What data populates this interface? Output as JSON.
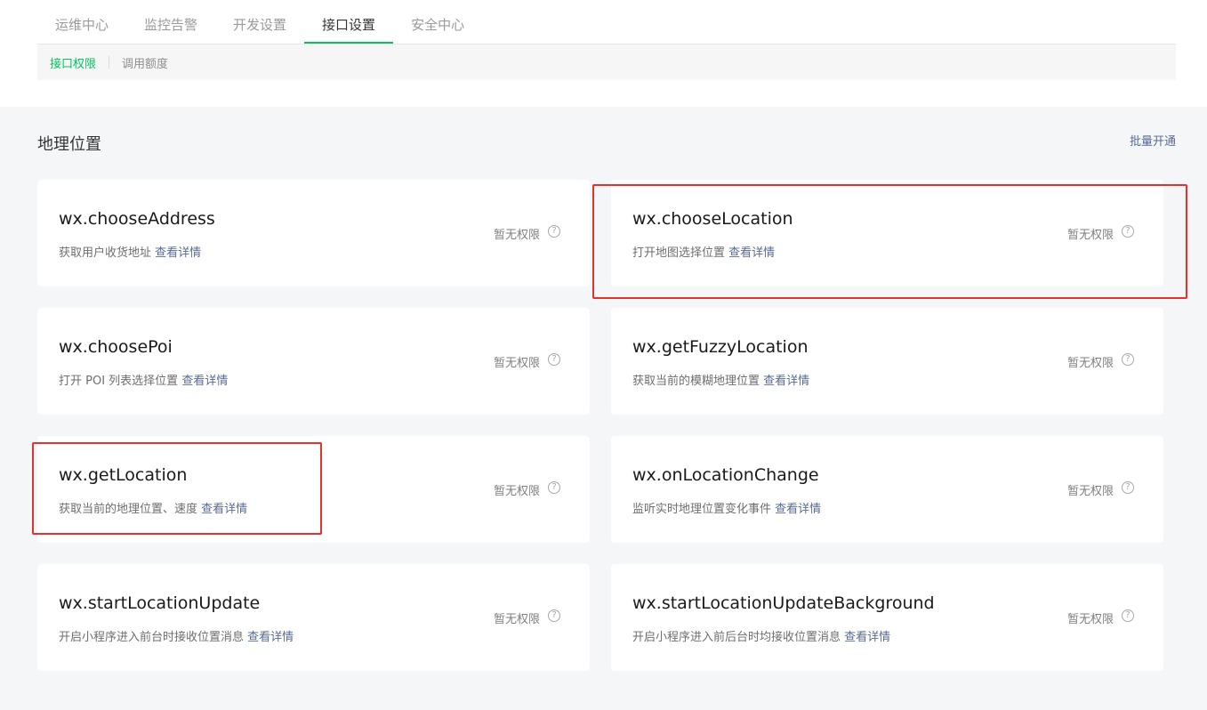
{
  "tabs": [
    {
      "label": "运维中心",
      "active": false
    },
    {
      "label": "监控告警",
      "active": false
    },
    {
      "label": "开发设置",
      "active": false
    },
    {
      "label": "接口设置",
      "active": true
    },
    {
      "label": "安全中心",
      "active": false
    }
  ],
  "subtabs": [
    {
      "label": "接口权限",
      "active": true
    },
    {
      "label": "调用额度",
      "active": false
    }
  ],
  "section": {
    "title": "地理位置",
    "batch_action": "批量开通"
  },
  "apis": [
    {
      "name": "wx.chooseAddress",
      "desc": "获取用户收货地址",
      "link": "查看详情",
      "status": "暂无权限",
      "help": "?"
    },
    {
      "name": "wx.chooseLocation",
      "desc": "打开地图选择位置",
      "link": "查看详情",
      "status": "暂无权限",
      "help": "?"
    },
    {
      "name": "wx.choosePoi",
      "desc": "打开 POI 列表选择位置",
      "link": "查看详情",
      "status": "暂无权限",
      "help": "?"
    },
    {
      "name": "wx.getFuzzyLocation",
      "desc": "获取当前的模糊地理位置",
      "link": "查看详情",
      "status": "暂无权限",
      "help": "?"
    },
    {
      "name": "wx.getLocation",
      "desc": "获取当前的地理位置、速度",
      "link": "查看详情",
      "status": "暂无权限",
      "help": "?"
    },
    {
      "name": "wx.onLocationChange",
      "desc": "监听实时地理位置变化事件",
      "link": "查看详情",
      "status": "暂无权限",
      "help": "?"
    },
    {
      "name": "wx.startLocationUpdate",
      "desc": "开启小程序进入前台时接收位置消息",
      "link": "查看详情",
      "status": "暂无权限",
      "help": "?"
    },
    {
      "name": "wx.startLocationUpdateBackground",
      "desc": "开启小程序进入前后台时均接收位置消息",
      "link": "查看详情",
      "status": "暂无权限",
      "help": "?"
    }
  ],
  "colors": {
    "accent": "#07c160",
    "link": "#576b95",
    "highlight": "#e5322d",
    "background": "#f5f6f7"
  }
}
